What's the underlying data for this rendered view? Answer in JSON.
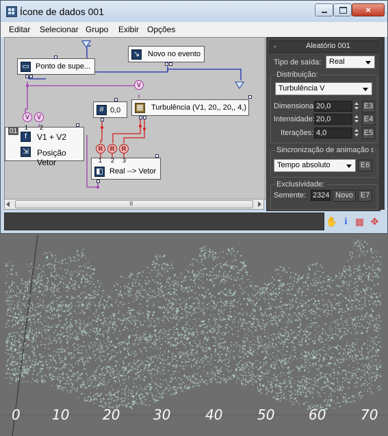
{
  "window": {
    "title": "Ícone de dados 001",
    "close_glyph": "×"
  },
  "menu": {
    "items": [
      "Editar",
      "Selecionar",
      "Grupo",
      "Exibir",
      "Opções"
    ]
  },
  "nodes": {
    "ponto": "Ponto de supe...",
    "novo_evento": "Novo no evento",
    "turbulencia": "Turbulência (V1, 20,, 20,, 4,)",
    "hash_value": "0,0",
    "hash_glyph": "#",
    "v1v2": "V1 + V2",
    "posicao": "Posição Vetor",
    "real_vetor": "Real --> Vetor",
    "row_number": "01",
    "port_numbers": [
      "1",
      "2"
    ],
    "r_port_numbers": [
      "1",
      "2",
      "3"
    ],
    "v_label": "V",
    "r_label": "R",
    "f_glyph": "f"
  },
  "panel": {
    "header": "Aleatório 001",
    "collapse": "-",
    "tipo_label": "Tipo de saída:",
    "tipo_value": "Real",
    "distrib_label": "Distribuição:",
    "distrib_value": "Turbulência V",
    "dim_label": "Dimensionar:",
    "dim_value": "20,0",
    "dim_btn": "E3",
    "int_label": "Intensidade:",
    "int_value": "20,0",
    "int_btn": "E4",
    "iter_label": "Iterações:",
    "iter_value": "4,0",
    "iter_btn": "E5",
    "sync_label": "Sincronização de animação de",
    "sync_value": "Tempo absoluto",
    "sync_btn": "E6",
    "excl_label": "Exclusividade:",
    "seed_label": "Semente:",
    "seed_value": "2324",
    "novo_btn": "Novo",
    "e7_btn": "E7"
  },
  "status_icons": [
    "hand-icon",
    "info-icon",
    "grid-icon",
    "move-icon"
  ],
  "viewport": {
    "axis_labels": [
      "0",
      "10",
      "20",
      "30",
      "40",
      "50",
      "60",
      "70"
    ],
    "particle_color": "#cdf5f0"
  },
  "colors": {
    "purple_wire": "#a03fb0",
    "red_wire": "#d42020",
    "blue_wire": "#1a2fb0"
  }
}
